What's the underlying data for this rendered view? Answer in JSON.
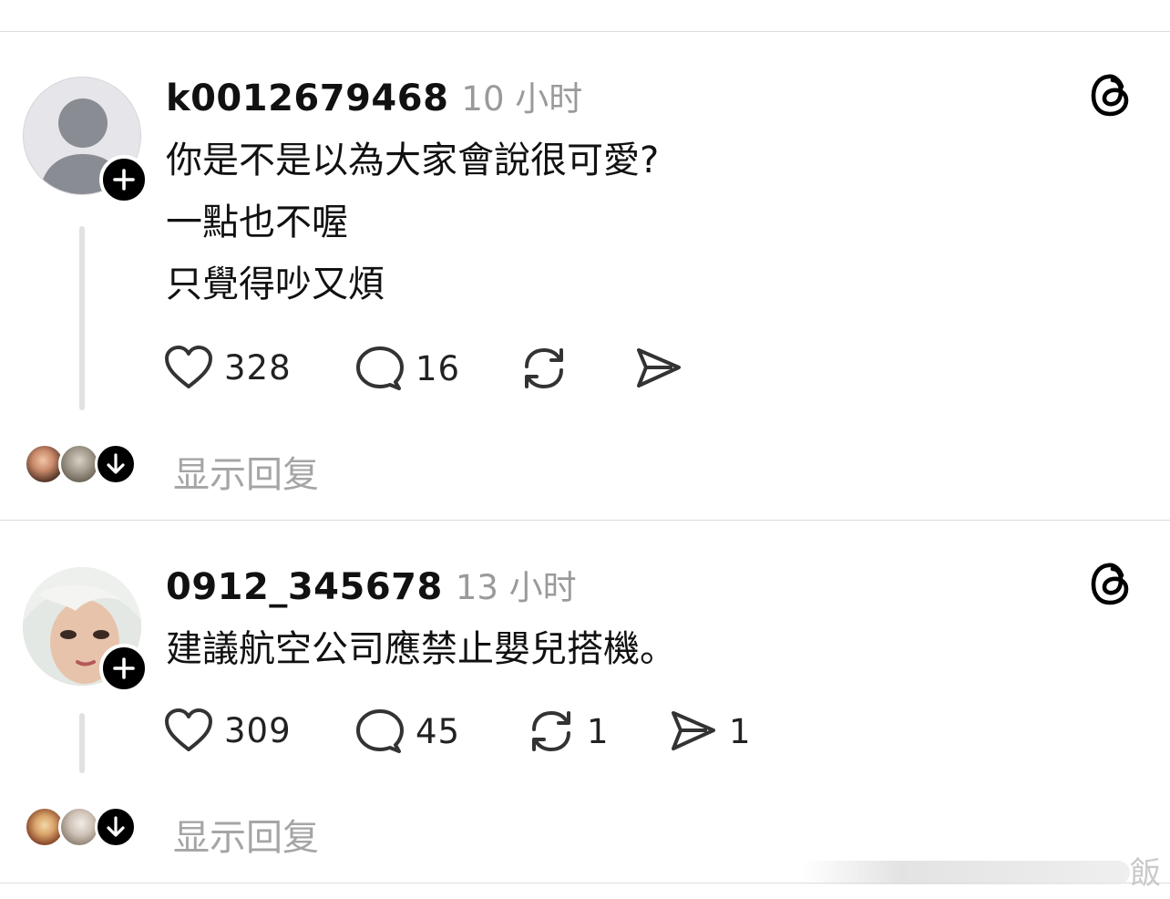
{
  "posts": [
    {
      "username": "k0012679468",
      "time": "10 小时",
      "lines": [
        "你是不是以為大家會說很可愛?",
        "一點也不喔",
        "只覺得吵又煩"
      ],
      "likes": "328",
      "comments": "16",
      "reposts": "",
      "shares": "",
      "show_replies": "显示回复"
    },
    {
      "username": "0912_345678",
      "time": "13 小时",
      "lines": [
        "建議航空公司應禁止嬰兒搭機。"
      ],
      "likes": "309",
      "comments": "45",
      "reposts": "1",
      "shares": "1",
      "show_replies": "显示回复"
    }
  ],
  "watermark": "飯"
}
